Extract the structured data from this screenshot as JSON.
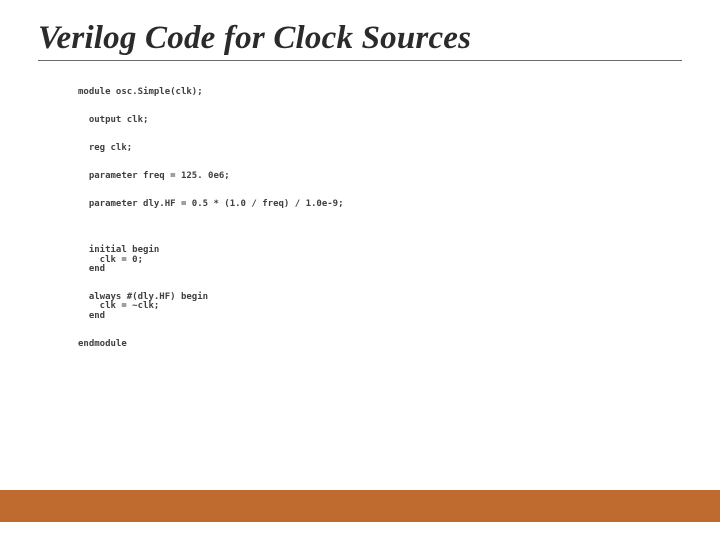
{
  "slide": {
    "title": "Verilog Code for Clock Sources"
  },
  "code": {
    "l1": "module osc.Simple(clk);",
    "l2": "  output clk;",
    "l3": "  reg clk;",
    "l4": "  parameter freq = 125. 0e6;",
    "l5": "  parameter dly.HF = 0.5 * (1.0 / freq) / 1.0e-9;",
    "l6": "  initial begin",
    "l7": "    clk = 0;",
    "l8": "  end",
    "l9": "  always #(dly.HF) begin",
    "l10": "    clk = ~clk;",
    "l11": "  end",
    "l12": "endmodule"
  },
  "watermark": ""
}
